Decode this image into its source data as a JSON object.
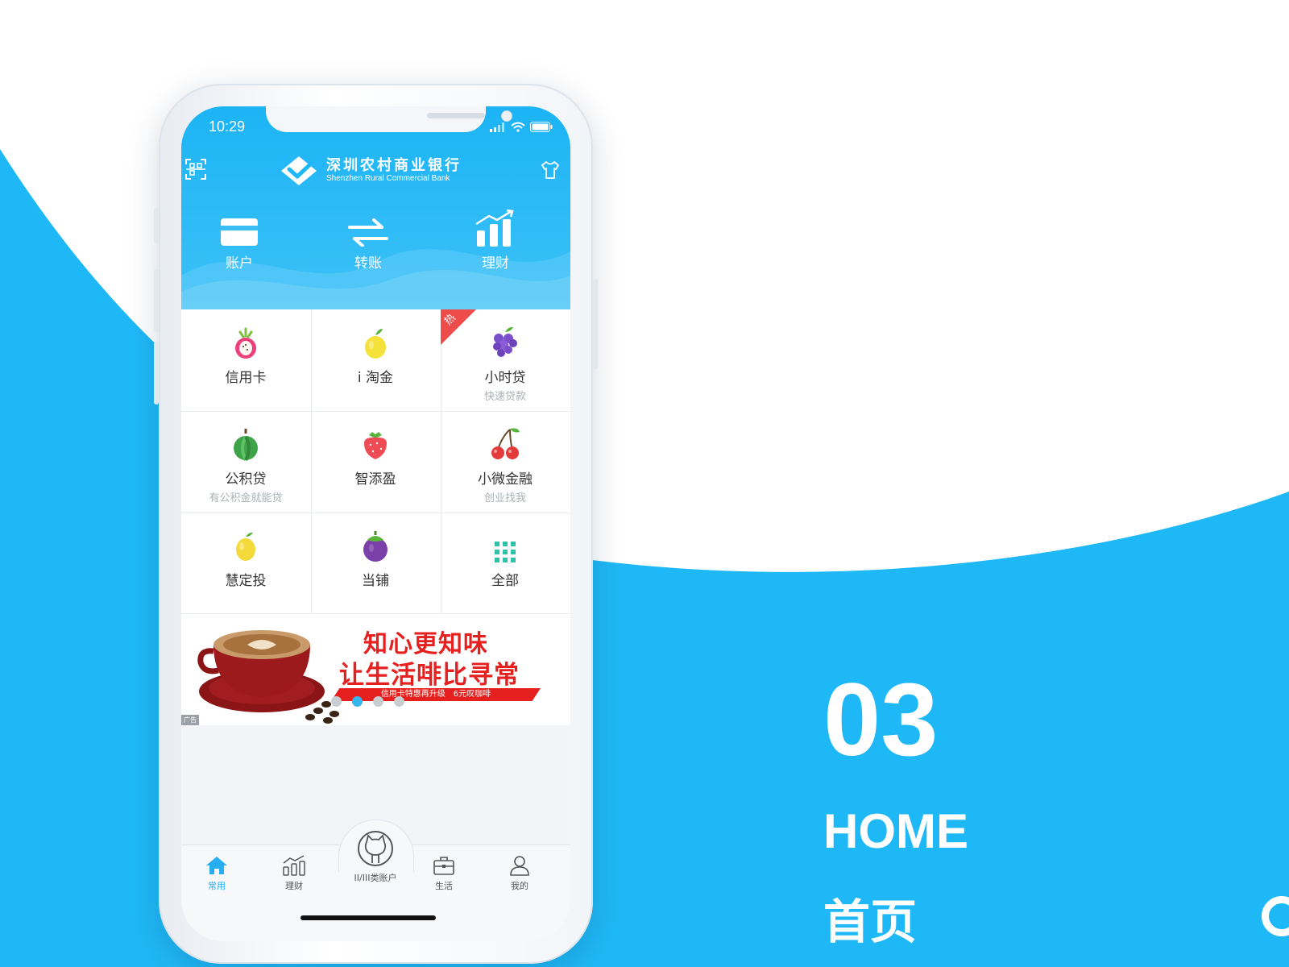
{
  "colors": {
    "accent": "#1fb8f6",
    "hot_ribbon": "#ee4b4b",
    "ad_red": "#e6201f",
    "text_dark": "#333333",
    "text_muted": "#aab0b6"
  },
  "status_bar": {
    "time": "10:29",
    "icons": [
      "signal-icon",
      "wifi-icon",
      "battery-icon"
    ]
  },
  "header": {
    "logo_cn": "深圳农村商业银行",
    "logo_en": "Shenzhen Rural Commercial Bank",
    "left_icon": "qr-scan-icon",
    "right_icon": "shirt-icon"
  },
  "quick_actions": [
    {
      "label": "账户",
      "icon": "card-icon"
    },
    {
      "label": "转账",
      "icon": "transfer-icon"
    },
    {
      "label": "理财",
      "icon": "chart-icon"
    }
  ],
  "services": [
    {
      "label": "信用卡",
      "sub": "",
      "icon": "dragonfruit-icon"
    },
    {
      "label": "i 淘金",
      "sub": "",
      "icon": "lemon-icon"
    },
    {
      "label": "小时贷",
      "sub": "快速贷款",
      "icon": "grape-icon",
      "badge": "热"
    },
    {
      "label": "公积贷",
      "sub": "有公积金就能贷",
      "icon": "guava-icon"
    },
    {
      "label": "智添盈",
      "sub": "",
      "icon": "strawberry-icon"
    },
    {
      "label": "小微金融",
      "sub": "创业找我",
      "icon": "cherry-icon"
    },
    {
      "label": "慧定投",
      "sub": "",
      "icon": "lemon-icon"
    },
    {
      "label": "当铺",
      "sub": "",
      "icon": "mangosteen-icon"
    },
    {
      "label": "全部",
      "sub": "",
      "icon": "grid-icon"
    }
  ],
  "banner": {
    "line1": "知心更知味",
    "line2": "让生活啡比寻常",
    "promo": "信用卡特惠再升级　6元叹咖啡",
    "ad_tag": "广告",
    "carousel_count": 4,
    "carousel_active_index": 1
  },
  "tabbar": {
    "items": [
      {
        "label": "常用",
        "icon": "home-icon",
        "active": true
      },
      {
        "label": "理财",
        "icon": "chart-icon",
        "active": false
      },
      {
        "label": "II/III类账户",
        "icon": "mascot-icon",
        "active": false
      },
      {
        "label": "生活",
        "icon": "briefcase-icon",
        "active": false
      },
      {
        "label": "我的",
        "icon": "user-icon",
        "active": false
      }
    ]
  },
  "section": {
    "number": "03",
    "title_en": "HOME",
    "title_cn": "首页"
  }
}
